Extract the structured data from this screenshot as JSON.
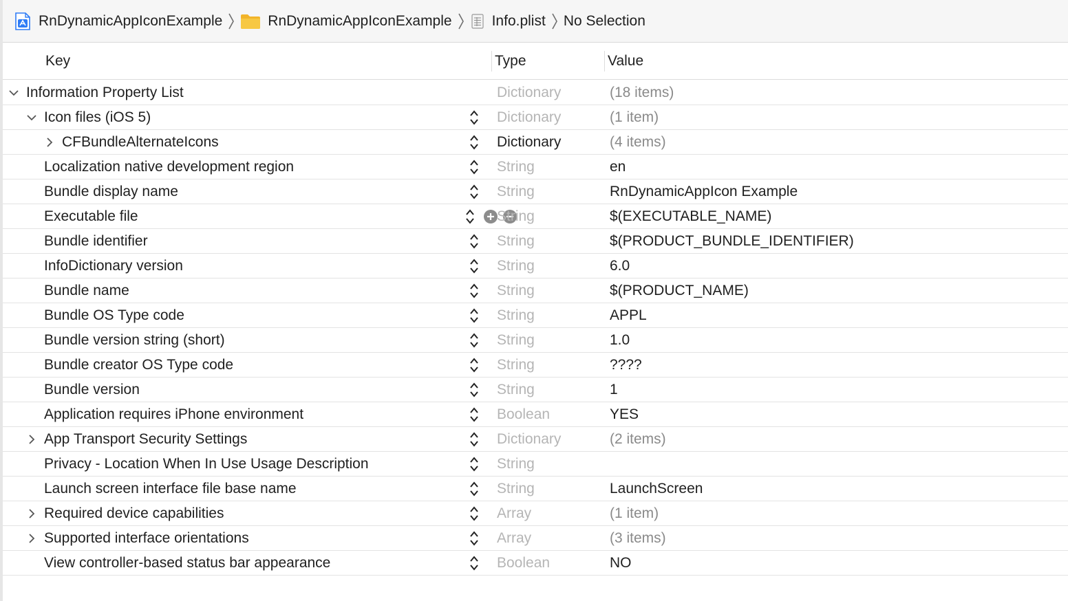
{
  "breadcrumb": {
    "items": [
      {
        "label": "RnDynamicAppIconExample",
        "icon": "xcode-project-icon"
      },
      {
        "label": "RnDynamicAppIconExample",
        "icon": "folder-icon"
      },
      {
        "label": "Info.plist",
        "icon": "plist-file-icon"
      },
      {
        "label": "No Selection",
        "icon": ""
      }
    ]
  },
  "columns": {
    "key": "Key",
    "type": "Type",
    "value": "Value"
  },
  "colors": {
    "folder": "#f7c843",
    "project": "#2f7cf6",
    "muted_type": "#b5b5b5",
    "muted_value": "#8a8a8a"
  },
  "rows": [
    {
      "key": "Information Property List",
      "type": "Dictionary",
      "value": "(18 items)",
      "depth": 0,
      "disclosure": "expanded",
      "controls": "none",
      "type_muted": true,
      "value_muted": true
    },
    {
      "key": "Icon files (iOS 5)",
      "type": "Dictionary",
      "value": "(1 item)",
      "depth": 1,
      "disclosure": "expanded",
      "controls": "stepper",
      "type_muted": true,
      "value_muted": true
    },
    {
      "key": "CFBundleAlternateIcons",
      "type": "Dictionary",
      "value": "(4 items)",
      "depth": 2,
      "disclosure": "collapsed",
      "controls": "stepper",
      "type_muted": false,
      "value_muted": true
    },
    {
      "key": "Localization native development region",
      "type": "String",
      "value": "en",
      "depth": 1,
      "disclosure": "none",
      "controls": "stepper",
      "type_muted": true,
      "value_muted": false
    },
    {
      "key": "Bundle display name",
      "type": "String",
      "value": "RnDynamicAppIcon Example",
      "depth": 1,
      "disclosure": "none",
      "controls": "stepper",
      "type_muted": true,
      "value_muted": false
    },
    {
      "key": "Executable file",
      "type": "String",
      "value": "$(EXECUTABLE_NAME)",
      "depth": 1,
      "disclosure": "none",
      "controls": "stepper-add-remove",
      "type_muted": true,
      "value_muted": false
    },
    {
      "key": "Bundle identifier",
      "type": "String",
      "value": "$(PRODUCT_BUNDLE_IDENTIFIER)",
      "depth": 1,
      "disclosure": "none",
      "controls": "stepper",
      "type_muted": true,
      "value_muted": false
    },
    {
      "key": "InfoDictionary version",
      "type": "String",
      "value": "6.0",
      "depth": 1,
      "disclosure": "none",
      "controls": "stepper",
      "type_muted": true,
      "value_muted": false
    },
    {
      "key": "Bundle name",
      "type": "String",
      "value": "$(PRODUCT_NAME)",
      "depth": 1,
      "disclosure": "none",
      "controls": "stepper",
      "type_muted": true,
      "value_muted": false
    },
    {
      "key": "Bundle OS Type code",
      "type": "String",
      "value": "APPL",
      "depth": 1,
      "disclosure": "none",
      "controls": "stepper",
      "type_muted": true,
      "value_muted": false
    },
    {
      "key": "Bundle version string (short)",
      "type": "String",
      "value": "1.0",
      "depth": 1,
      "disclosure": "none",
      "controls": "stepper",
      "type_muted": true,
      "value_muted": false
    },
    {
      "key": "Bundle creator OS Type code",
      "type": "String",
      "value": "????",
      "depth": 1,
      "disclosure": "none",
      "controls": "stepper",
      "type_muted": true,
      "value_muted": false
    },
    {
      "key": "Bundle version",
      "type": "String",
      "value": "1",
      "depth": 1,
      "disclosure": "none",
      "controls": "stepper",
      "type_muted": true,
      "value_muted": false
    },
    {
      "key": "Application requires iPhone environment",
      "type": "Boolean",
      "value": "YES",
      "depth": 1,
      "disclosure": "none",
      "controls": "stepper",
      "type_muted": true,
      "value_muted": false
    },
    {
      "key": "App Transport Security Settings",
      "type": "Dictionary",
      "value": "(2 items)",
      "depth": 1,
      "disclosure": "collapsed",
      "controls": "stepper",
      "type_muted": true,
      "value_muted": true
    },
    {
      "key": "Privacy - Location When In Use Usage Description",
      "type": "String",
      "value": "",
      "depth": 1,
      "disclosure": "none",
      "controls": "stepper",
      "type_muted": true,
      "value_muted": false
    },
    {
      "key": "Launch screen interface file base name",
      "type": "String",
      "value": "LaunchScreen",
      "depth": 1,
      "disclosure": "none",
      "controls": "stepper",
      "type_muted": true,
      "value_muted": false
    },
    {
      "key": "Required device capabilities",
      "type": "Array",
      "value": "(1 item)",
      "depth": 1,
      "disclosure": "collapsed",
      "controls": "stepper",
      "type_muted": true,
      "value_muted": true
    },
    {
      "key": "Supported interface orientations",
      "type": "Array",
      "value": "(3 items)",
      "depth": 1,
      "disclosure": "collapsed",
      "controls": "stepper",
      "type_muted": true,
      "value_muted": true
    },
    {
      "key": "View controller-based status bar appearance",
      "type": "Boolean",
      "value": "NO",
      "depth": 1,
      "disclosure": "none",
      "controls": "stepper",
      "type_muted": true,
      "value_muted": false
    }
  ]
}
